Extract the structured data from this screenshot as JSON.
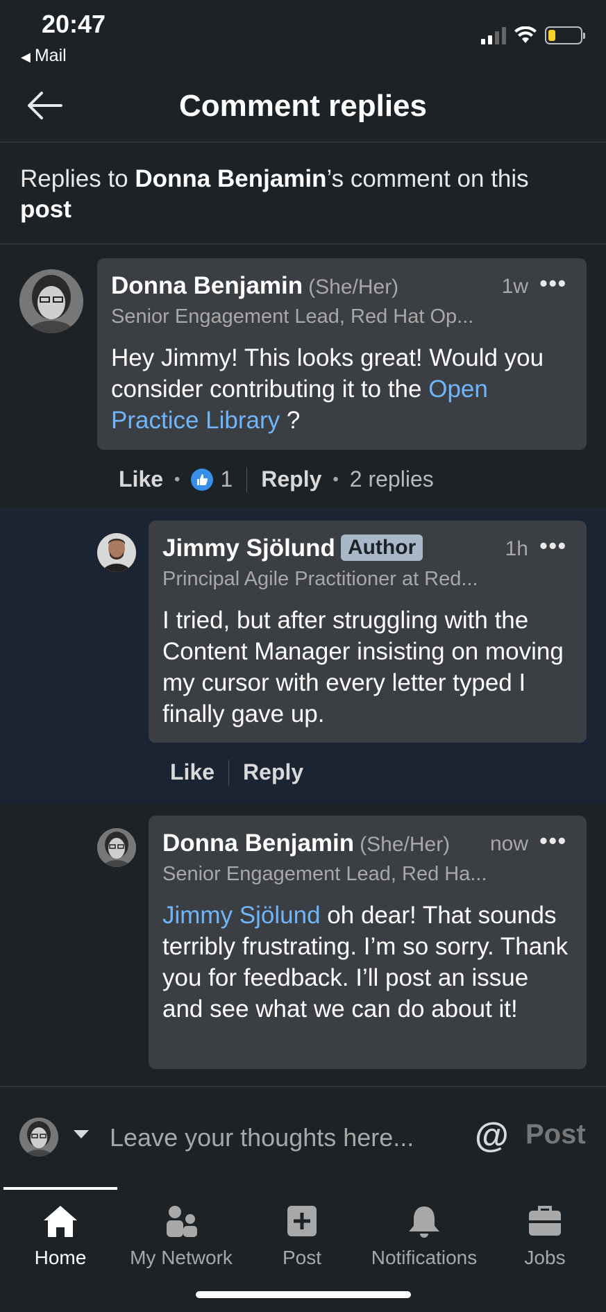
{
  "status_bar": {
    "time": "20:47",
    "back_app": "Mail"
  },
  "header": {
    "title": "Comment replies"
  },
  "context": {
    "prefix": "Replies to ",
    "author": "Donna Benjamin",
    "middle": "’s comment on this ",
    "target": "post"
  },
  "comments": [
    {
      "name": "Donna Benjamin",
      "pronoun": "(She/Her)",
      "time": "1w",
      "headline": "Senior Engagement Lead, Red Hat Op...",
      "text_before": "Hey Jimmy! This looks great! Would you consider contributing it to the ",
      "link": "Open Practice Library",
      "text_after": " ?",
      "actions": {
        "like": "Like",
        "reaction_count": "1",
        "reply": "Reply",
        "replies": "2 replies"
      }
    },
    {
      "name": "Jimmy Sjölund",
      "badge": "Author",
      "time": "1h",
      "headline": "Principal Agile Practitioner at Red...",
      "text": "I tried, but after struggling with the Content Manager insisting on moving my cursor with every letter typed I finally gave up.",
      "actions": {
        "like": "Like",
        "reply": "Reply"
      }
    },
    {
      "name": "Donna Benjamin",
      "pronoun": "(She/Her)",
      "time": "now",
      "headline": "Senior Engagement Lead, Red Ha...",
      "mention": "Jimmy Sjölund",
      "text": " oh dear! That sounds terribly frustrating. I’m so sorry. Thank you for feedback. I’ll post an issue and see what we can do about it!"
    }
  ],
  "composer": {
    "placeholder": "Leave your thoughts here...",
    "at": "@",
    "post": "Post"
  },
  "tabs": [
    {
      "label": "Home",
      "icon": "home-icon",
      "active": true
    },
    {
      "label": "My Network",
      "icon": "network-icon"
    },
    {
      "label": "Post",
      "icon": "plus-square-icon"
    },
    {
      "label": "Notifications",
      "icon": "bell-icon"
    },
    {
      "label": "Jobs",
      "icon": "briefcase-icon"
    }
  ],
  "colors": {
    "background": "#1d2226",
    "bubble": "#3b3f43",
    "link": "#70b5f9",
    "highlight": "#1b2433"
  }
}
